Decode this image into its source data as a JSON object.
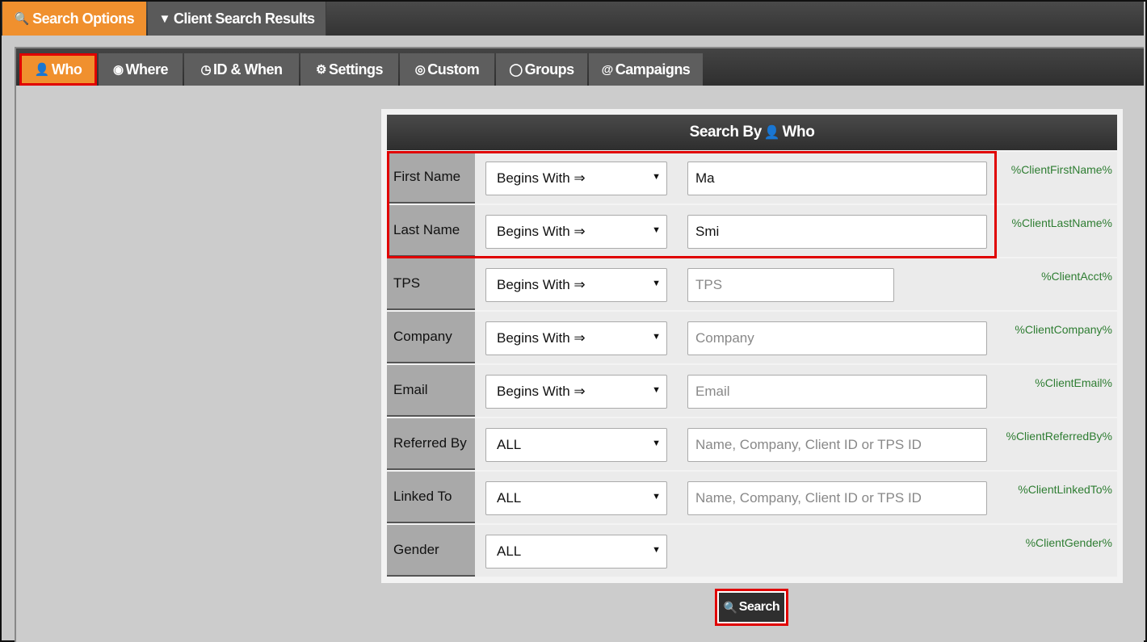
{
  "top_tabs": {
    "search_options": {
      "icon": "search-icon",
      "label": "Search Options"
    },
    "client_search_results": {
      "icon": "filter-icon",
      "label": "Client Search Results"
    }
  },
  "sub_tabs": [
    {
      "icon": "user-icon",
      "label": "Who"
    },
    {
      "icon": "map-marker-icon",
      "label": "Where"
    },
    {
      "icon": "clock-icon",
      "label": "ID & When"
    },
    {
      "icon": "gear-icon",
      "label": "Settings"
    },
    {
      "icon": "target-icon",
      "label": "Custom"
    },
    {
      "icon": "groups-icon",
      "label": "Groups"
    },
    {
      "icon": "at-icon",
      "label": "Campaigns"
    }
  ],
  "search_header": {
    "prefix": "Search By",
    "icon": "user-icon",
    "suffix": "Who"
  },
  "rows": [
    {
      "label": "First Name",
      "operator": "Begins With ⇒",
      "value": "Ma",
      "placeholder": "",
      "variable": "%ClientFirstName%"
    },
    {
      "label": "Last Name",
      "operator": "Begins With ⇒",
      "value": "Smi",
      "placeholder": "",
      "variable": "%ClientLastName%"
    },
    {
      "label": "TPS",
      "operator": "Begins With ⇒",
      "value": "",
      "placeholder": "TPS",
      "variable": "%ClientAcct%"
    },
    {
      "label": "Company",
      "operator": "Begins With ⇒",
      "value": "",
      "placeholder": "Company",
      "variable": "%ClientCompany%"
    },
    {
      "label": "Email",
      "operator": "Begins With ⇒",
      "value": "",
      "placeholder": "Email",
      "variable": "%ClientEmail%"
    },
    {
      "label": "Referred By",
      "operator": "ALL",
      "value": "",
      "placeholder": "Name, Company, Client ID or TPS ID",
      "variable": "%ClientReferredBy%"
    },
    {
      "label": "Linked To",
      "operator": "ALL",
      "value": "",
      "placeholder": "Name, Company, Client ID or TPS ID",
      "variable": "%ClientLinkedTo%"
    },
    {
      "label": "Gender",
      "operator": "ALL",
      "variable": "%ClientGender%"
    }
  ],
  "search_button": {
    "icon": "search-icon",
    "label": "Search"
  },
  "colors": {
    "accent": "#f0902e",
    "highlight": "#e00000",
    "variable_text": "#2e7d32",
    "dark_bar": "#333333"
  }
}
